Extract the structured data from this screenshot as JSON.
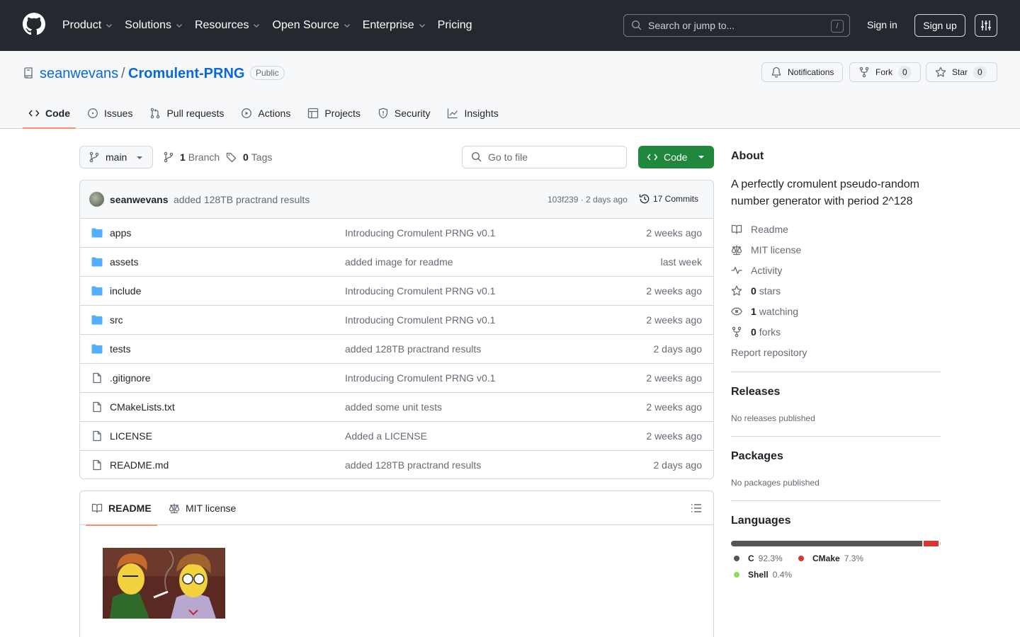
{
  "header": {
    "nav": [
      "Product",
      "Solutions",
      "Resources",
      "Open Source",
      "Enterprise",
      "Pricing"
    ],
    "search_placeholder": "Search or jump to...",
    "search_shortcut": "/",
    "signin": "Sign in",
    "signup": "Sign up"
  },
  "repo": {
    "owner": "seanwevans",
    "name": "Cromulent-PRNG",
    "visibility": "Public",
    "notifications": "Notifications",
    "fork_label": "Fork",
    "fork_count": "0",
    "star_label": "Star",
    "star_count": "0"
  },
  "tabs": [
    "Code",
    "Issues",
    "Pull requests",
    "Actions",
    "Projects",
    "Security",
    "Insights"
  ],
  "toolbar": {
    "branch": "main",
    "branch_count": "1",
    "branch_label": "Branch",
    "tag_count": "0",
    "tag_label": "Tags",
    "go_to_file": "Go to file",
    "code": "Code"
  },
  "commit": {
    "author": "seanwevans",
    "message": "added 128TB practrand results",
    "hash_time": "103f239 · 2 days ago",
    "commits": "17 Commits"
  },
  "files": [
    {
      "type": "dir",
      "name": "apps",
      "message": "Introducing Cromulent PRNG v0.1",
      "date": "2 weeks ago"
    },
    {
      "type": "dir",
      "name": "assets",
      "message": "added image for readme",
      "date": "last week"
    },
    {
      "type": "dir",
      "name": "include",
      "message": "Introducing Cromulent PRNG v0.1",
      "date": "2 weeks ago"
    },
    {
      "type": "dir",
      "name": "src",
      "message": "Introducing Cromulent PRNG v0.1",
      "date": "2 weeks ago"
    },
    {
      "type": "dir",
      "name": "tests",
      "message": "added 128TB practrand results",
      "date": "2 days ago"
    },
    {
      "type": "file",
      "name": ".gitignore",
      "message": "Introducing Cromulent PRNG v0.1",
      "date": "2 weeks ago"
    },
    {
      "type": "file",
      "name": "CMakeLists.txt",
      "message": "added some unit tests",
      "date": "2 weeks ago"
    },
    {
      "type": "file",
      "name": "LICENSE",
      "message": "Added a LICENSE",
      "date": "2 weeks ago"
    },
    {
      "type": "file",
      "name": "README.md",
      "message": "added 128TB practrand results",
      "date": "2 days ago"
    }
  ],
  "readme": {
    "tab1": "README",
    "tab2": "MIT license"
  },
  "about": {
    "heading": "About",
    "description": "A perfectly cromulent pseudo-random number generator with period 2^128",
    "readme": "Readme",
    "license": "MIT license",
    "activity": "Activity",
    "stars_count": "0",
    "stars_label": "stars",
    "watching_count": "1",
    "watching_label": "watching",
    "forks_count": "0",
    "forks_label": "forks",
    "report": "Report repository"
  },
  "releases": {
    "heading": "Releases",
    "note": "No releases published"
  },
  "packages": {
    "heading": "Packages",
    "note": "No packages published"
  },
  "languages": {
    "heading": "Languages",
    "items": [
      {
        "name": "C",
        "percent": "92.3%",
        "value": 92.3,
        "color": "#555555"
      },
      {
        "name": "CMake",
        "percent": "7.3%",
        "value": 7.3,
        "color": "#da3434"
      },
      {
        "name": "Shell",
        "percent": "0.4%",
        "value": 0.4,
        "color": "#89e051"
      }
    ]
  }
}
